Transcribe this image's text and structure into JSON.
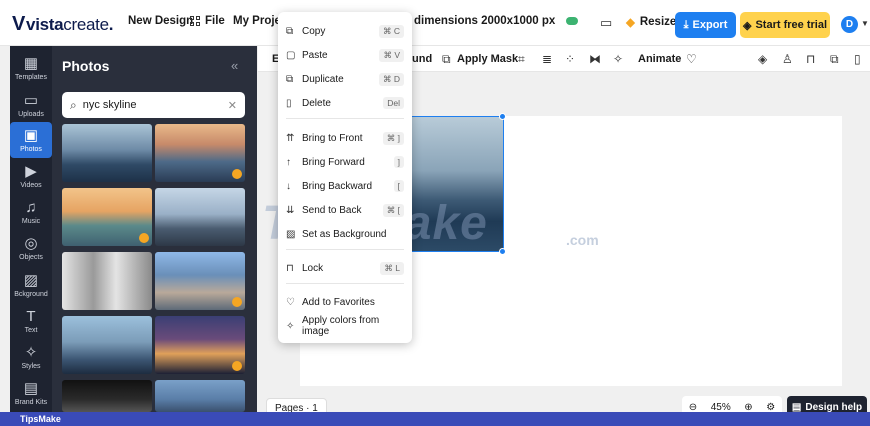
{
  "brand": {
    "logo_bold": "vista",
    "logo_light": "create",
    "dot": "."
  },
  "topbar": {
    "new_design": "New Design",
    "file": "File",
    "my_projects": "My Projects",
    "dimensions": "dimensions 2000x1000 px",
    "resize": "Resize",
    "export": "Export",
    "trial": "Start free trial",
    "avatar_initial": "D"
  },
  "rail": {
    "items": [
      {
        "label": "Templates",
        "icon": "templates-icon"
      },
      {
        "label": "Uploads",
        "icon": "uploads-icon"
      },
      {
        "label": "Photos",
        "icon": "photos-icon"
      },
      {
        "label": "Videos",
        "icon": "videos-icon"
      },
      {
        "label": "Music",
        "icon": "music-icon"
      },
      {
        "label": "Objects",
        "icon": "objects-icon"
      },
      {
        "label": "Bckground",
        "icon": "background-icon"
      },
      {
        "label": "Text",
        "icon": "text-icon"
      },
      {
        "label": "Styles",
        "icon": "styles-icon"
      },
      {
        "label": "Brand Kits",
        "icon": "brand-kits-icon"
      }
    ]
  },
  "panel": {
    "title": "Photos",
    "search_value": "nyc skyline"
  },
  "toolbar": {
    "e_label": "E",
    "und_label": "und",
    "apply_mask": "Apply Mask",
    "animate": "Animate"
  },
  "context_menu": {
    "items": [
      {
        "label": "Copy",
        "shortcut": "⌘ C",
        "icon": "copy-icon"
      },
      {
        "label": "Paste",
        "shortcut": "⌘ V",
        "icon": "paste-icon"
      },
      {
        "label": "Duplicate",
        "shortcut": "⌘ D",
        "icon": "duplicate-icon"
      },
      {
        "label": "Delete",
        "shortcut": "Del",
        "icon": "delete-icon"
      },
      {
        "label": "Bring to Front",
        "shortcut": "⌘ ]",
        "icon": "bring-front-icon"
      },
      {
        "label": "Bring Forward",
        "shortcut": "]",
        "icon": "bring-forward-icon"
      },
      {
        "label": "Bring Backward",
        "shortcut": "[",
        "icon": "bring-backward-icon"
      },
      {
        "label": "Send to Back",
        "shortcut": "⌘ [",
        "icon": "send-back-icon"
      },
      {
        "label": "Set as Background",
        "shortcut": "",
        "icon": "set-background-icon"
      },
      {
        "label": "Lock",
        "shortcut": "⌘ L",
        "icon": "lock-icon"
      },
      {
        "label": "Add to Favorites",
        "shortcut": "",
        "icon": "heart-icon"
      },
      {
        "label": "Apply colors from image",
        "shortcut": "",
        "icon": "sparkle-icon"
      }
    ]
  },
  "canvas": {
    "watermark": "TipsMake",
    "watermark_com": ".com"
  },
  "bottom": {
    "pages": "Pages · 1",
    "zoom": "45%",
    "help": "Design help",
    "footer": "TipsMake"
  }
}
